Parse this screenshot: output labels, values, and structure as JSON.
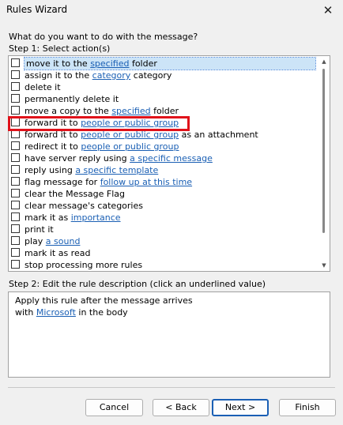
{
  "window": {
    "title": "Rules Wizard",
    "close_glyph": "✕"
  },
  "question": "What do you want to do with the message?",
  "step1_label": "Step 1: Select action(s)",
  "actions": [
    {
      "pre": "move it to the ",
      "link": "specified",
      "post": " folder"
    },
    {
      "pre": "assign it to the ",
      "link": "category",
      "post": " category"
    },
    {
      "pre": "delete it",
      "link": "",
      "post": ""
    },
    {
      "pre": "permanently delete it",
      "link": "",
      "post": ""
    },
    {
      "pre": "move a copy to the ",
      "link": "specified",
      "post": " folder"
    },
    {
      "pre": "forward it to ",
      "link": "people or public group",
      "post": ""
    },
    {
      "pre": "forward it to ",
      "link": "people or public group",
      "post": " as an attachment"
    },
    {
      "pre": "redirect it to ",
      "link": "people or public group",
      "post": ""
    },
    {
      "pre": "have server reply using ",
      "link": "a specific message",
      "post": ""
    },
    {
      "pre": "reply using ",
      "link": "a specific template",
      "post": ""
    },
    {
      "pre": "flag message for ",
      "link": "follow up at this time",
      "post": ""
    },
    {
      "pre": "clear the Message Flag",
      "link": "",
      "post": ""
    },
    {
      "pre": "clear message's categories",
      "link": "",
      "post": ""
    },
    {
      "pre": "mark it as ",
      "link": "importance",
      "post": ""
    },
    {
      "pre": "print it",
      "link": "",
      "post": ""
    },
    {
      "pre": "play ",
      "link": "a sound",
      "post": ""
    },
    {
      "pre": "mark it as read",
      "link": "",
      "post": ""
    },
    {
      "pre": "stop processing more rules",
      "link": "",
      "post": ""
    }
  ],
  "step2_label": "Step 2: Edit the rule description (click an underlined value)",
  "description": {
    "line1": "Apply this rule after the message arrives",
    "line2_pre": "with ",
    "line2_link": "Microsoft",
    "line2_post": " in the body"
  },
  "buttons": {
    "cancel": "Cancel",
    "back": "< Back",
    "next": "Next >",
    "finish": "Finish"
  }
}
